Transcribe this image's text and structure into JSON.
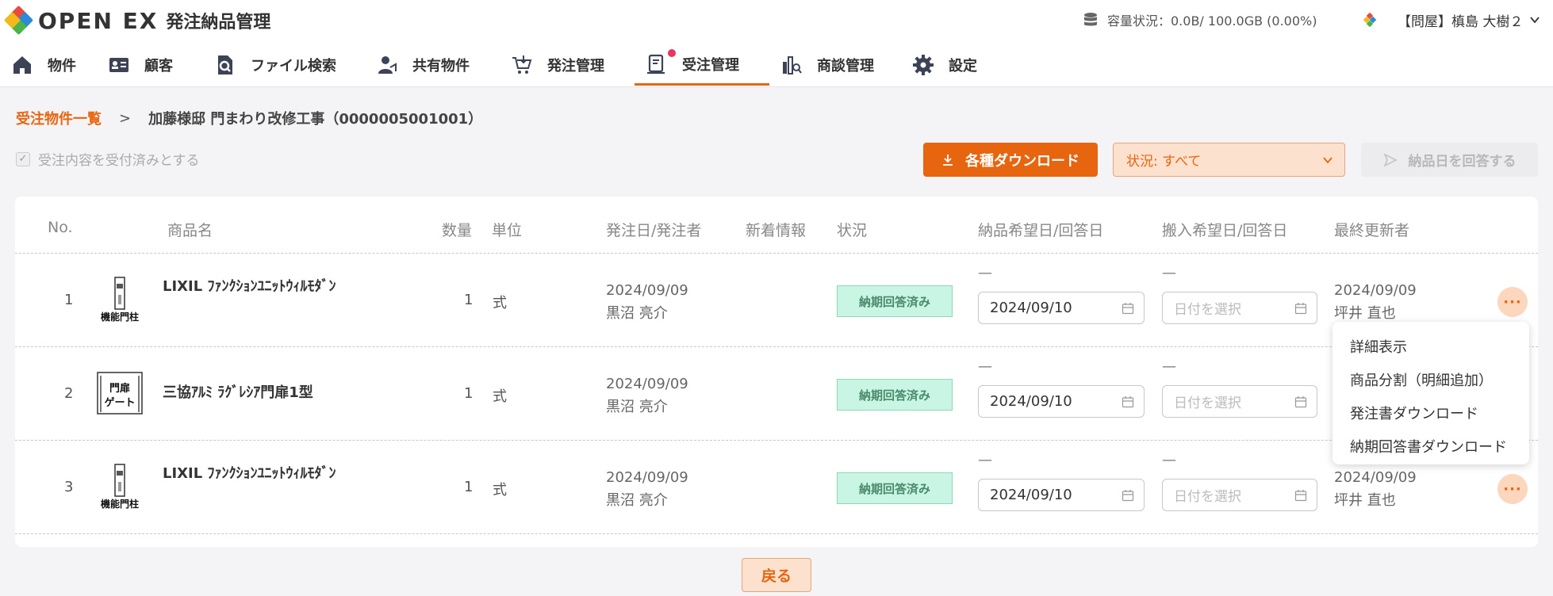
{
  "app": {
    "brand": "OPEN EX",
    "title": "発注納品管理",
    "storage_label": "容量状況：0.0B/ 100.0GB (0.00%)",
    "user_label": "【問屋】槙島 大樹２"
  },
  "nav": {
    "items": [
      {
        "label": "物件",
        "icon": "home-icon"
      },
      {
        "label": "顧客",
        "icon": "id-card-icon"
      },
      {
        "label": "ファイル検索",
        "icon": "file-search-icon"
      },
      {
        "label": "共有物件",
        "icon": "shared-user-icon"
      },
      {
        "label": "発注管理",
        "icon": "cart-icon"
      },
      {
        "label": "受注管理",
        "icon": "order-receive-icon",
        "active": true,
        "notification": true
      },
      {
        "label": "商談管理",
        "icon": "negotiation-icon"
      },
      {
        "label": "設定",
        "icon": "gear-icon"
      }
    ]
  },
  "breadcrumb": {
    "link": "受注物件一覧",
    "separator": ">",
    "current": "加藤様邸 門まわり改修工事（0000005001001）"
  },
  "toolbar": {
    "accept_checkbox_label": "受注内容を受付済みとする",
    "download_label": "各種ダウンロード",
    "status_select_value": "状況: すべて",
    "answer_label": "納品日を回答する"
  },
  "table": {
    "headers": {
      "no": "No.",
      "name": "商品名",
      "qty": "数量",
      "unit": "単位",
      "order": "発注日/発注者",
      "news": "新着情報",
      "status": "状況",
      "delivery": "納品希望日/回答日",
      "carry": "搬入希望日/回答日",
      "updater": "最終更新者"
    },
    "rows": [
      {
        "no": "1",
        "thumb_icon": "gate-pillar-icon",
        "thumb_text": "機能門柱",
        "name": "LIXIL ﾌｧﾝｸｼｮﾝﾕﾆｯﾄｳｨﾙﾓﾀﾞﾝ",
        "qty": "1",
        "unit": "式",
        "order_date": "2024/09/09",
        "orderer": "黒沼 亮介",
        "status": "納期回答済み",
        "delivery_dash": "—",
        "delivery_date": "2024/09/10",
        "carry_dash": "—",
        "carry_placeholder": "日付を選択",
        "updated_date": "2024/09/09",
        "updater": "坪井 直也"
      },
      {
        "no": "2",
        "thumb_icon": "gate-door-icon",
        "thumb_text": "門扉ゲート",
        "name": "三協ｱﾙﾐ ﾗｸﾞﾚｼｱ門扉1型",
        "qty": "1",
        "unit": "式",
        "order_date": "2024/09/09",
        "orderer": "黒沼 亮介",
        "status": "納期回答済み",
        "delivery_dash": "—",
        "delivery_date": "2024/09/10",
        "carry_dash": "—",
        "carry_placeholder": "日付を選択",
        "updated_date": "",
        "updater": ""
      },
      {
        "no": "3",
        "thumb_icon": "gate-pillar-icon",
        "thumb_text": "機能門柱",
        "name": "LIXIL ﾌｧﾝｸｼｮﾝﾕﾆｯﾄｳｨﾙﾓﾀﾞﾝ",
        "qty": "1",
        "unit": "式",
        "order_date": "2024/09/09",
        "orderer": "黒沼 亮介",
        "status": "納期回答済み",
        "delivery_dash": "—",
        "delivery_date": "2024/09/10",
        "carry_dash": "—",
        "carry_placeholder": "日付を選択",
        "updated_date": "2024/09/09",
        "updater": "坪井 直也"
      }
    ]
  },
  "row_menu": {
    "items": [
      "詳細表示",
      "商品分割（明細追加）",
      "発注書ダウンロード",
      "納期回答書ダウンロード"
    ]
  },
  "footer": {
    "back_label": "戻る"
  },
  "colors": {
    "accent": "#e8650f",
    "status_bg": "#c9f5e4"
  }
}
